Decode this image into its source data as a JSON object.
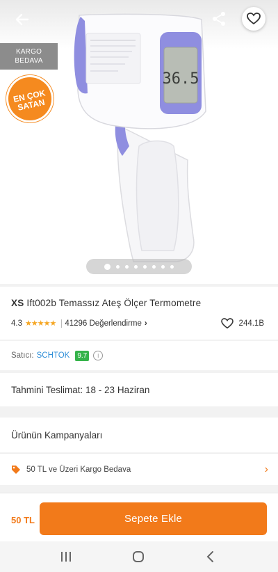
{
  "hero": {
    "cargo_badge_line1": "KARGO",
    "cargo_badge_line2": "BEDAVA",
    "best_badge_line1": "EN ÇOK",
    "best_badge_line2": "SATAN",
    "device_display": "36.5",
    "carousel_count": 8,
    "carousel_active": 0
  },
  "product": {
    "brand": "XS",
    "name": "Ift002b Temassız Ateş Ölçer Termometre",
    "rating": "4.3",
    "stars_filled": 4.3,
    "reviews_text": "41296 Değerlendirme",
    "reviews_chevron": "›",
    "favorites_count": "244.1B"
  },
  "seller": {
    "label": "Satıcı:",
    "name": "SCHTOK",
    "score": "9.7",
    "info_glyph": "i"
  },
  "delivery": {
    "text": "Tahmini Teslimat: 18 - 23 Haziran"
  },
  "campaigns": {
    "title": "Ürünün Kampanyaları",
    "items": [
      {
        "label": "50 TL ve Üzeri Kargo Bedava",
        "chevron": "›"
      }
    ]
  },
  "bottom": {
    "price": "50 TL",
    "add_to_cart": "Sepete Ekle"
  },
  "colors": {
    "accent": "#f27a1a",
    "seller_link": "#2f8fd8",
    "score_badge": "#35b34a",
    "device_accent": "#8f8ee0"
  },
  "icons": [
    "back-arrow-icon",
    "share-icon",
    "heart-icon",
    "tag-icon",
    "chevron-right-icon",
    "info-icon",
    "recent-apps-icon",
    "home-icon",
    "back-nav-icon"
  ]
}
